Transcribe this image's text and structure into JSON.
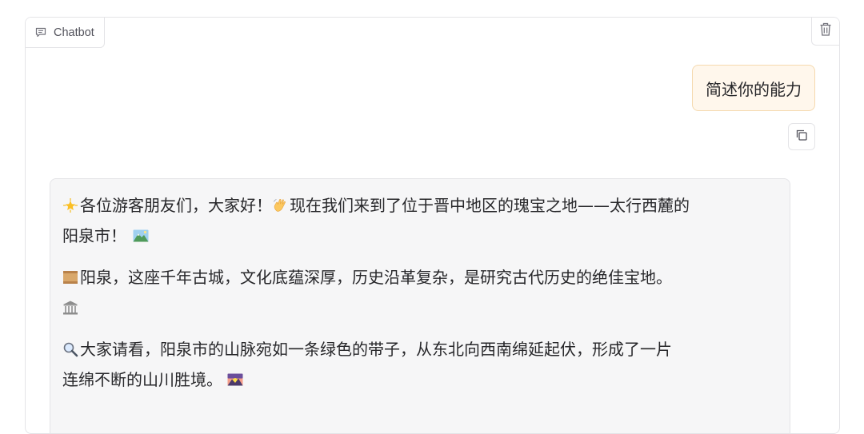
{
  "header": {
    "label": "Chatbot"
  },
  "user_message": {
    "text": "简述你的能力"
  },
  "bot_message": {
    "paragraphs": [
      {
        "lead_icon": "glowing-star-icon",
        "text": "各位游客朋友们，大家好！",
        "mid_icon": "waving-hand-icon",
        "text2": "现在我们来到了位于晋中地区的瑰宝之地——太行西麓的",
        "line2": "阳泉市！",
        "tail_icon": "mountain-landscape-icon"
      },
      {
        "lead_icon": "scroll-icon",
        "text": "阳泉，这座千年古城，文化底蕴深厚，历史沿革复杂，是研究古代历史的绝佳宝地。",
        "tail_icon": "classical-building-icon"
      },
      {
        "lead_icon": "magnifying-glass-icon",
        "text": "大家请看，阳泉市的山脉宛如一条绿色的带子，从东北向西南绵延起伏，形成了一片",
        "line2": "连绵不断的山川胜境。",
        "tail_icon": "sunrise-over-mountains-icon"
      }
    ]
  },
  "colors": {
    "user_bubble_bg": "#fff7ec",
    "user_bubble_border": "#f5d9ae",
    "bot_bubble_bg": "#f6f6f7",
    "border": "#e4e4e7"
  }
}
